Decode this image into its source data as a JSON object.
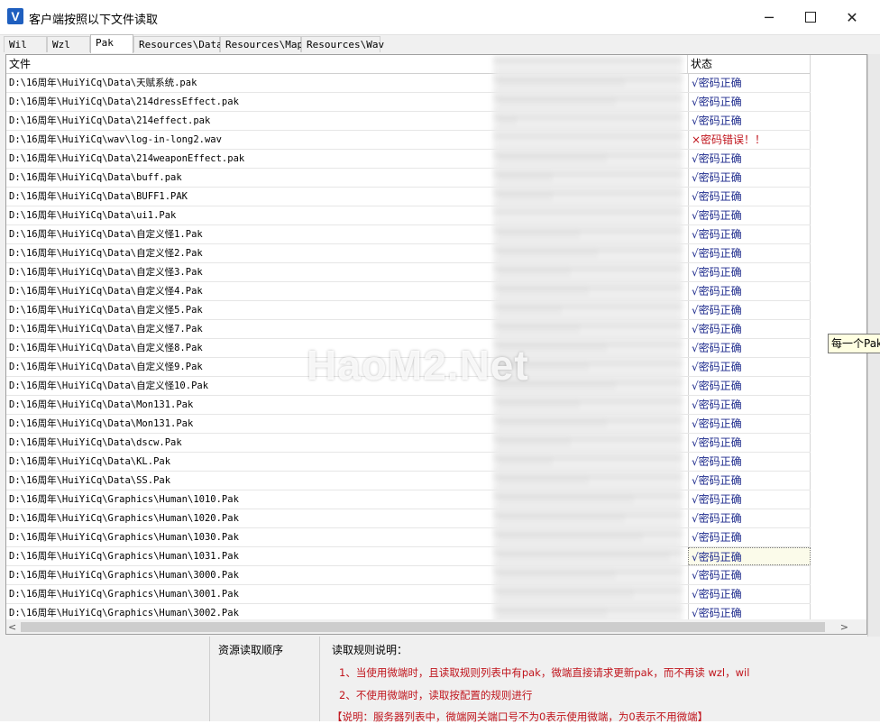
{
  "window": {
    "title": "客户端按照以下文件读取",
    "icon_letter": "V",
    "controls": {
      "minimize": "─",
      "close": "✕"
    }
  },
  "tabs": [
    {
      "label": "Wil",
      "active": false
    },
    {
      "label": "Wzl",
      "active": false
    },
    {
      "label": "Pak",
      "active": true
    },
    {
      "label": "Resources\\Data",
      "active": false
    },
    {
      "label": "Resources\\Map",
      "active": false
    },
    {
      "label": "Resources\\Wav",
      "active": false
    }
  ],
  "list": {
    "headers": {
      "file": "文件",
      "status": "状态"
    },
    "rows": [
      {
        "path": "D:\\16周年\\HuiYiCq\\Data\\天赋系统.pak",
        "status": "√密码正确",
        "error": false
      },
      {
        "path": "D:\\16周年\\HuiYiCq\\Data\\214dressEffect.pak",
        "status": "√密码正确",
        "error": false
      },
      {
        "path": "D:\\16周年\\HuiYiCq\\Data\\214effect.pak",
        "status": "√密码正确",
        "error": false
      },
      {
        "path": "D:\\16周年\\HuiYiCq\\wav\\log-in-long2.wav",
        "status": "×密码错误！！",
        "error": true
      },
      {
        "path": "D:\\16周年\\HuiYiCq\\Data\\214weaponEffect.pak",
        "status": "√密码正确",
        "error": false
      },
      {
        "path": "D:\\16周年\\HuiYiCq\\Data\\buff.pak",
        "status": "√密码正确",
        "error": false
      },
      {
        "path": "D:\\16周年\\HuiYiCq\\Data\\BUFF1.PAK",
        "status": "√密码正确",
        "error": false
      },
      {
        "path": "D:\\16周年\\HuiYiCq\\Data\\ui1.Pak",
        "status": "√密码正确",
        "error": false
      },
      {
        "path": "D:\\16周年\\HuiYiCq\\Data\\自定义怪1.Pak",
        "status": "√密码正确",
        "error": false
      },
      {
        "path": "D:\\16周年\\HuiYiCq\\Data\\自定义怪2.Pak",
        "status": "√密码正确",
        "error": false
      },
      {
        "path": "D:\\16周年\\HuiYiCq\\Data\\自定义怪3.Pak",
        "status": "√密码正确",
        "error": false
      },
      {
        "path": "D:\\16周年\\HuiYiCq\\Data\\自定义怪4.Pak",
        "status": "√密码正确",
        "error": false
      },
      {
        "path": "D:\\16周年\\HuiYiCq\\Data\\自定义怪5.Pak",
        "status": "√密码正确",
        "error": false
      },
      {
        "path": "D:\\16周年\\HuiYiCq\\Data\\自定义怪7.Pak",
        "status": "√密码正确",
        "error": false
      },
      {
        "path": "D:\\16周年\\HuiYiCq\\Data\\自定义怪8.Pak",
        "status": "√密码正确",
        "error": false
      },
      {
        "path": "D:\\16周年\\HuiYiCq\\Data\\自定义怪9.Pak",
        "status": "√密码正确",
        "error": false
      },
      {
        "path": "D:\\16周年\\HuiYiCq\\Data\\自定义怪10.Pak",
        "status": "√密码正确",
        "error": false
      },
      {
        "path": "D:\\16周年\\HuiYiCq\\Data\\Mon131.Pak",
        "status": "√密码正确",
        "error": false
      },
      {
        "path": "D:\\16周年\\HuiYiCq\\Data\\Mon131.Pak",
        "status": "√密码正确",
        "error": false
      },
      {
        "path": "D:\\16周年\\HuiYiCq\\Data\\dscw.Pak",
        "status": "√密码正确",
        "error": false
      },
      {
        "path": "D:\\16周年\\HuiYiCq\\Data\\KL.Pak",
        "status": "√密码正确",
        "error": false
      },
      {
        "path": "D:\\16周年\\HuiYiCq\\Data\\SS.Pak",
        "status": "√密码正确",
        "error": false
      },
      {
        "path": "D:\\16周年\\HuiYiCq\\Graphics\\Human\\1010.Pak",
        "status": "√密码正确",
        "error": false
      },
      {
        "path": "D:\\16周年\\HuiYiCq\\Graphics\\Human\\1020.Pak",
        "status": "√密码正确",
        "error": false
      },
      {
        "path": "D:\\16周年\\HuiYiCq\\Graphics\\Human\\1030.Pak",
        "status": "√密码正确",
        "error": false
      },
      {
        "path": "D:\\16周年\\HuiYiCq\\Graphics\\Human\\1031.Pak",
        "status": "√密码正确",
        "error": false,
        "selected": true
      },
      {
        "path": "D:\\16周年\\HuiYiCq\\Graphics\\Human\\3000.Pak",
        "status": "√密码正确",
        "error": false
      },
      {
        "path": "D:\\16周年\\HuiYiCq\\Graphics\\Human\\3001.Pak",
        "status": "√密码正确",
        "error": false
      },
      {
        "path": "D:\\16周年\\HuiYiCq\\Graphics\\Human\\3002.Pak",
        "status": "√密码正确",
        "error": false
      }
    ]
  },
  "scrollbar": {
    "left_arrow": "<",
    "right_arrow": ">"
  },
  "watermark": "HaoM2.Net",
  "tooltip": "每一个Pak",
  "bottom": {
    "order_title": "资源读取顺序",
    "rules_title": "读取规则说明：",
    "rule1": "1、当使用微端时，且读取规则列表中有pak，微端直接请求更新pak，而不再读 wzl，wil",
    "rule2": "2、不使用微端时，读取按配置的规则进行",
    "rule3": "【说明：服务器列表中，微端网关端口号不为0表示使用微端，为0表示不用微端】"
  },
  "colors": {
    "ok": "#1d2a8c",
    "error": "#c0141c",
    "accent": "#1f5fbf"
  }
}
